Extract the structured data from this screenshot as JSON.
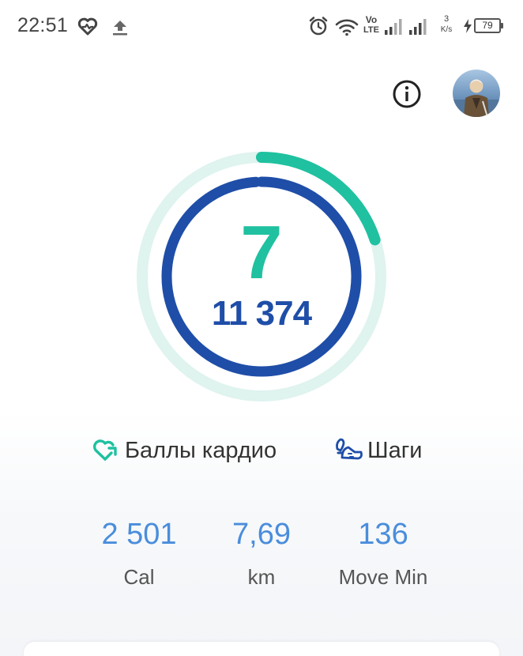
{
  "status_bar": {
    "time": "22:51",
    "icons": [
      "heart-pulse-icon",
      "upload-icon",
      "alarm-icon",
      "wifi-icon",
      "volte-icon",
      "signal-icon",
      "network-speed-icon",
      "charging-icon",
      "battery-icon"
    ],
    "volte_top": "Vo",
    "volte_bottom": "LTE",
    "speed_value": "3",
    "speed_unit": "K/s",
    "battery_level": "79"
  },
  "header": {
    "info_icon": "info-icon",
    "avatar": "profile-avatar"
  },
  "rings": {
    "goal_value": "7",
    "steps_value": "11 374",
    "outer_progress": 0.2,
    "inner_progress": 0.99,
    "colors": {
      "outer_track": "#dff3ef",
      "outer_fill": "#1fc1a0",
      "inner_track": "#e8eef8",
      "inner_fill": "#1f4ea8"
    }
  },
  "legend": [
    {
      "icon": "heart-points-icon",
      "label": "Баллы кардио"
    },
    {
      "icon": "steps-icon",
      "label": "Шаги"
    }
  ],
  "stats": [
    {
      "value": "2 501",
      "unit": "Cal"
    },
    {
      "value": "7,69",
      "unit": "km"
    },
    {
      "value": "136",
      "unit": "Move Min"
    }
  ],
  "colors": {
    "stat_value": "#4a8ddc",
    "text": "#333333"
  }
}
